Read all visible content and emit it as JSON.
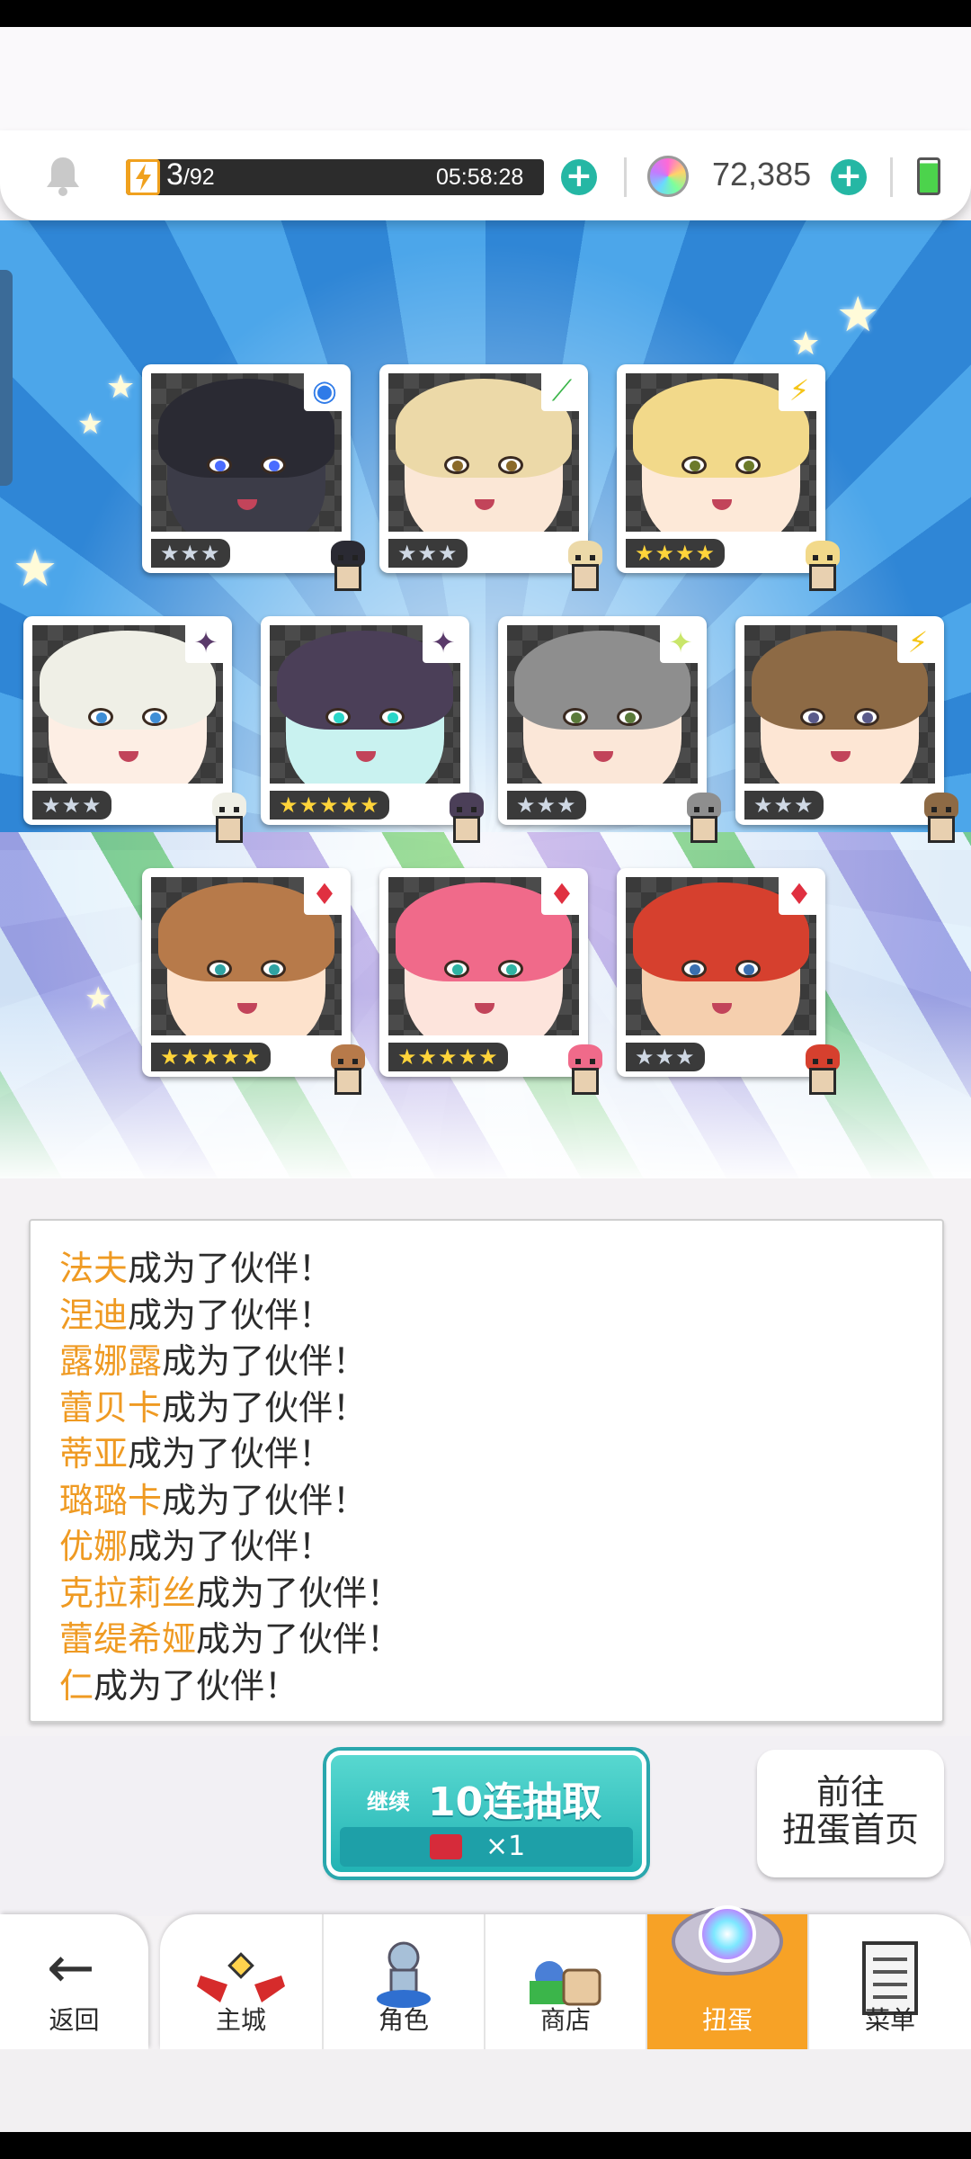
{
  "header": {
    "stamina_current": "3",
    "stamina_max": "/92",
    "stamina_level": 0.033,
    "timer": "05:58:28",
    "gems": "72,385",
    "icons": [
      "bell-icon",
      "lightning-icon",
      "plus-icon",
      "gem-icon",
      "battery-icon"
    ]
  },
  "cards": [
    {
      "name": "card-1",
      "stars": "★★★",
      "gold": false,
      "attr": "◉",
      "attr_color": "#2f7be8",
      "hair": "#2a2a33",
      "skin": "#3c3c48",
      "iris": "#4a6cff"
    },
    {
      "name": "card-2",
      "stars": "★★★",
      "gold": false,
      "attr": "⟋",
      "attr_color": "#3bb54a",
      "hair": "#ecd9a8",
      "skin": "#fbe7d6",
      "iris": "#8a6a2a"
    },
    {
      "name": "card-3",
      "stars": "★★★★",
      "gold": true,
      "attr": "⚡",
      "attr_color": "#f5c518",
      "hair": "#f2d98a",
      "skin": "#fde9d8",
      "iris": "#6b7a2a"
    },
    {
      "name": "card-4",
      "stars": "★★★",
      "gold": false,
      "attr": "✦",
      "attr_color": "#5a3a6a",
      "hair": "#efefe6",
      "skin": "#fdeee4",
      "iris": "#3f8ed6"
    },
    {
      "name": "card-5",
      "stars": "★★★★★",
      "gold": true,
      "attr": "✦",
      "attr_color": "#5a3a6a",
      "hair": "#4b3f58",
      "skin": "#c9f2f0",
      "iris": "#2ad6c8"
    },
    {
      "name": "card-6",
      "stars": "★★★",
      "gold": false,
      "attr": "✦",
      "attr_color": "#c9e66a",
      "hair": "#8e8e8e",
      "skin": "#fbe7d8",
      "iris": "#5a7a3a"
    },
    {
      "name": "card-7",
      "stars": "★★★",
      "gold": false,
      "attr": "⚡",
      "attr_color": "#f5c518",
      "hair": "#8d6a45",
      "skin": "#fde6d4",
      "iris": "#5a5a8a"
    },
    {
      "name": "card-8",
      "stars": "★★★★★",
      "gold": true,
      "attr": "♦",
      "attr_color": "#e03040",
      "hair": "#b77a4a",
      "skin": "#fde2cc",
      "iris": "#2fa3a3"
    },
    {
      "name": "card-9",
      "stars": "★★★★★",
      "gold": true,
      "attr": "♦",
      "attr_color": "#e03040",
      "hair": "#f06a8a",
      "skin": "#fde4dc",
      "iris": "#2fb3a3"
    },
    {
      "name": "card-10",
      "stars": "★★★",
      "gold": false,
      "attr": "♦",
      "attr_color": "#e03040",
      "hair": "#d6402e",
      "skin": "#f5cfae",
      "iris": "#3a6fb0"
    }
  ],
  "log": {
    "suffix": "成为了伙伴！",
    "names": [
      "法夫",
      "涅迪",
      "露娜露",
      "蕾贝卡",
      "蒂亚",
      "璐璐卡",
      "优娜",
      "克拉莉丝",
      "蕾缇希娅",
      "仁"
    ]
  },
  "pull_button": {
    "prefix": "继续",
    "label": "10连抽取",
    "cost": "×1"
  },
  "gacha_home_button": {
    "line1": "前往",
    "line2": "扭蛋首页"
  },
  "nav": {
    "back": "返回",
    "tabs": [
      "主城",
      "角色",
      "商店",
      "扭蛋",
      "菜单"
    ],
    "active_tab": "扭蛋"
  },
  "colors": {
    "accent": "#f7a226",
    "teal": "#25b7a4",
    "name_highlight": "#ef9a22"
  }
}
